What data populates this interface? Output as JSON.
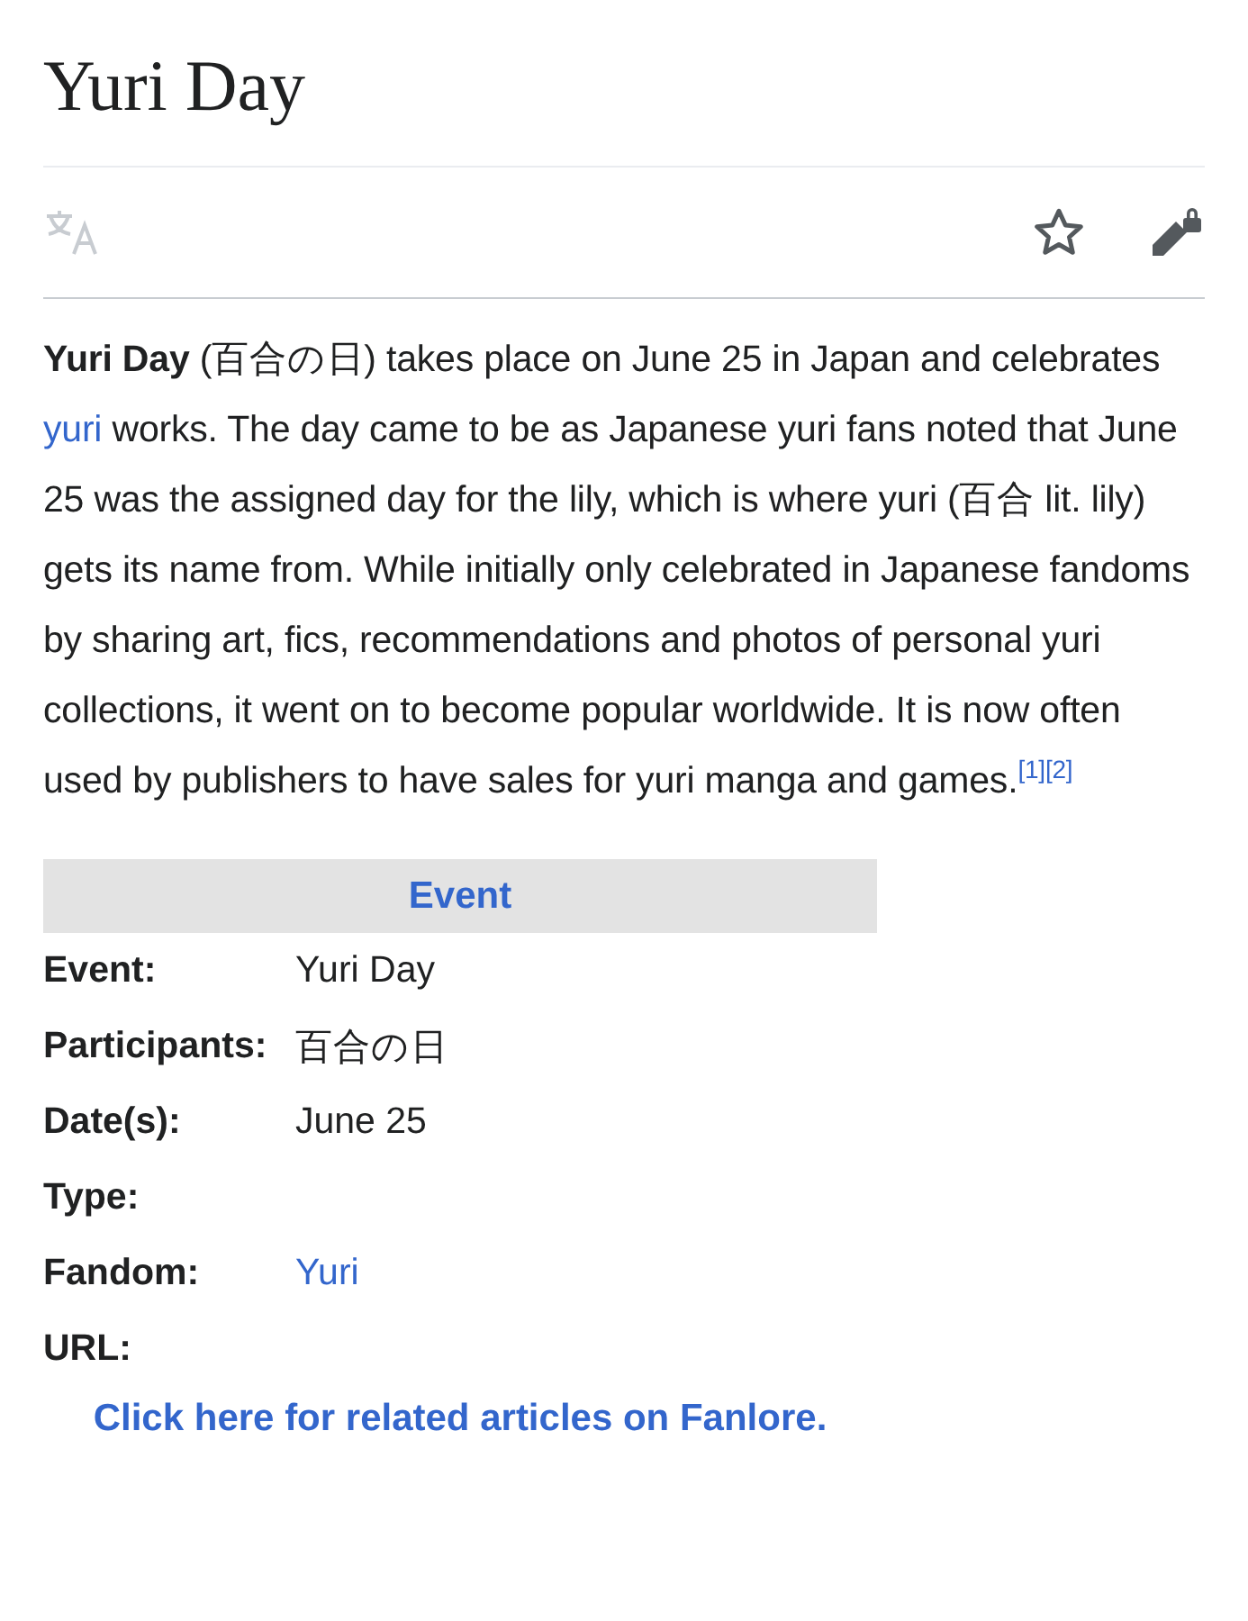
{
  "title": "Yuri Day",
  "toolbar": {
    "translate": {
      "disabled": true
    },
    "watch": {
      "selected": false
    },
    "edit": {
      "locked": true
    }
  },
  "intro": [
    {
      "kind": "bold",
      "text": "Yuri Day"
    },
    {
      "kind": "plain",
      "text": " (百合の日) takes place on June 25 in Japan and celebrates "
    },
    {
      "kind": "link",
      "text": "yuri"
    },
    {
      "kind": "plain",
      "text": " works. The day came to be as Japanese yuri fans noted that June 25 was the assigned day for the lily, which is where yuri (百合 lit. lily) gets its name from. While initially only celebrated in Japanese fandoms by sharing art, fics, recommendations and photos of personal yuri collections, it went on to become popular worldwide. It is now often used by publishers to have sales for yuri manga and games."
    },
    {
      "kind": "ref",
      "text": "[1]"
    },
    {
      "kind": "ref",
      "text": "[2]"
    }
  ],
  "infobox": {
    "heading": "Event",
    "rows": [
      {
        "label": "Event:",
        "value": "Yuri Day",
        "kind": "plain"
      },
      {
        "label": "Participants:",
        "value": "百合の日",
        "kind": "plain"
      },
      {
        "label": "Date(s):",
        "value": "June 25",
        "kind": "plain"
      },
      {
        "label": "Type:",
        "kind": "empty"
      },
      {
        "label": "Fandom:",
        "value": "Yuri",
        "kind": "link"
      },
      {
        "label": "URL:",
        "kind": "empty"
      }
    ],
    "footer_link": "Click here for related articles on Fanlore."
  }
}
